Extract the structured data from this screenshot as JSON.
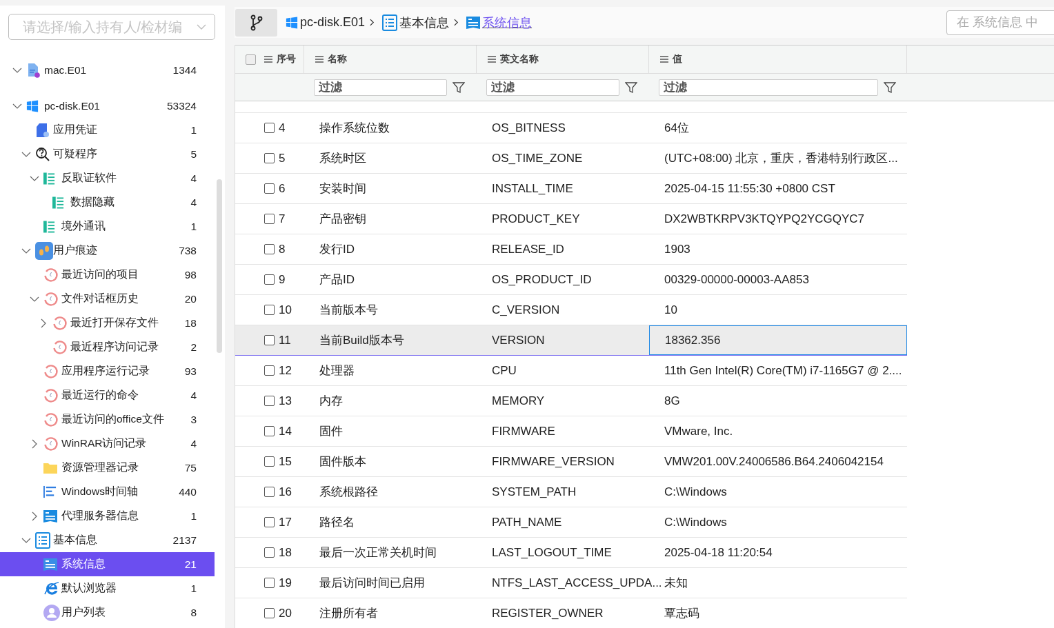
{
  "sidebar": {
    "owner_select": {
      "placeholder": "请选择/输入持有人/检材编"
    },
    "tree": [
      {
        "label": "mac.E01",
        "count": "1344",
        "kind": "disk-image",
        "expanded": true,
        "selected": false
      },
      {
        "label": "pc-disk.E01",
        "count": "53324",
        "kind": "windows",
        "expanded": true,
        "selected": false,
        "children": [
          {
            "label": "应用凭证",
            "count": "1",
            "kind": "credential",
            "selected": false
          },
          {
            "label": "可疑程序",
            "count": "5",
            "kind": "suspect",
            "expanded": true,
            "selected": false,
            "children": [
              {
                "label": "反取证软件",
                "count": "4",
                "kind": "green-list",
                "expanded": true,
                "selected": false,
                "children": [
                  {
                    "label": "数据隐藏",
                    "count": "4",
                    "kind": "green-list",
                    "selected": false
                  }
                ]
              },
              {
                "label": "境外通讯",
                "count": "1",
                "kind": "green-list",
                "selected": false
              }
            ]
          },
          {
            "label": "用户痕迹",
            "count": "738",
            "kind": "footprints",
            "expanded": true,
            "selected": false,
            "children": [
              {
                "label": "最近访问的项目",
                "count": "98",
                "kind": "history",
                "selected": false
              },
              {
                "label": "文件对话框历史",
                "count": "20",
                "kind": "history",
                "expanded": true,
                "selected": false,
                "children": [
                  {
                    "label": "最近打开保存文件",
                    "count": "18",
                    "kind": "history",
                    "expanded": false,
                    "selected": false
                  },
                  {
                    "label": "最近程序访问记录",
                    "count": "2",
                    "kind": "history",
                    "selected": false
                  }
                ]
              },
              {
                "label": "应用程序运行记录",
                "count": "93",
                "kind": "history",
                "selected": false
              },
              {
                "label": "最近运行的命令",
                "count": "4",
                "kind": "history",
                "selected": false
              },
              {
                "label": "最近访问的office文件",
                "count": "3",
                "kind": "history",
                "selected": false
              },
              {
                "label": "WinRAR访问记录",
                "count": "4",
                "kind": "history",
                "expanded": false,
                "selected": false
              },
              {
                "label": "资源管理器记录",
                "count": "75",
                "kind": "folder",
                "selected": false
              },
              {
                "label": "Windows时间轴",
                "count": "440",
                "kind": "timeline",
                "selected": false
              },
              {
                "label": "代理服务器信息",
                "count": "1",
                "kind": "card",
                "expanded": false,
                "selected": false
              }
            ]
          },
          {
            "label": "基本信息",
            "count": "2137",
            "kind": "doc-list",
            "expanded": true,
            "selected": false,
            "children": [
              {
                "label": "系统信息",
                "count": "21",
                "kind": "card",
                "selected": true
              },
              {
                "label": "默认浏览器",
                "count": "1",
                "kind": "browser",
                "selected": false
              },
              {
                "label": "用户列表",
                "count": "8",
                "kind": "user",
                "selected": false
              }
            ]
          }
        ]
      }
    ]
  },
  "breadcrumb": [
    {
      "label": "pc-disk.E01",
      "kind": "windows",
      "selected": false
    },
    {
      "label": "基本信息",
      "kind": "doc-list",
      "selected": false
    },
    {
      "label": "系统信息",
      "kind": "card",
      "selected": true
    }
  ],
  "search": {
    "placeholder": "在 系统信息 中"
  },
  "table": {
    "header_checked": false,
    "columns": [
      "序号",
      "名称",
      "英文名称",
      "值"
    ],
    "filters": [
      {
        "placeholder": "过滤"
      },
      {
        "placeholder": "过滤"
      },
      {
        "placeholder": "过滤"
      }
    ],
    "rows": [
      {
        "index": "4",
        "name": "操作系统位数",
        "english_name": "OS_BITNESS",
        "value": "64位",
        "checked": false,
        "selected": false
      },
      {
        "index": "5",
        "name": "系统时区",
        "english_name": "OS_TIME_ZONE",
        "value": "(UTC+08:00) 北京，重庆，香港特别行政区...",
        "checked": false,
        "selected": false
      },
      {
        "index": "6",
        "name": "安装时间",
        "english_name": "INSTALL_TIME",
        "value": "2025-04-15 11:55:30 +0800 CST",
        "checked": false,
        "selected": false
      },
      {
        "index": "7",
        "name": "产品密钥",
        "english_name": "PRODUCT_KEY",
        "value": "DX2WBTKRPV3KTQYPQ2YCGQYC7",
        "checked": false,
        "selected": false
      },
      {
        "index": "8",
        "name": "发行ID",
        "english_name": "RELEASE_ID",
        "value": "1903",
        "checked": false,
        "selected": false
      },
      {
        "index": "9",
        "name": "产品ID",
        "english_name": "OS_PRODUCT_ID",
        "value": "00329-00000-00003-AA853",
        "checked": false,
        "selected": false
      },
      {
        "index": "10",
        "name": "当前版本号",
        "english_name": "C_VERSION",
        "value": "10",
        "checked": false,
        "selected": false
      },
      {
        "index": "11",
        "name": "当前Build版本号",
        "english_name": "VERSION",
        "value": "18362.356",
        "checked": false,
        "selected": true
      },
      {
        "index": "12",
        "name": "处理器",
        "english_name": "CPU",
        "value": "11th Gen Intel(R) Core(TM) i7-1165G7 @ 2....",
        "checked": false,
        "selected": false
      },
      {
        "index": "13",
        "name": "内存",
        "english_name": "MEMORY",
        "value": "8G",
        "checked": false,
        "selected": false
      },
      {
        "index": "14",
        "name": "固件",
        "english_name": "FIRMWARE",
        "value": "VMware, Inc.",
        "checked": false,
        "selected": false
      },
      {
        "index": "15",
        "name": "固件版本",
        "english_name": "FIRMWARE_VERSION",
        "value": "VMW201.00V.24006586.B64.2406042154",
        "checked": false,
        "selected": false
      },
      {
        "index": "16",
        "name": "系统根路径",
        "english_name": "SYSTEM_PATH",
        "value": "C:\\Windows",
        "checked": false,
        "selected": false
      },
      {
        "index": "17",
        "name": "路径名",
        "english_name": "PATH_NAME",
        "value": "C:\\Windows",
        "checked": false,
        "selected": false
      },
      {
        "index": "18",
        "name": "最后一次正常关机时间",
        "english_name": "LAST_LOGOUT_TIME",
        "value": "2025-04-18 11:20:54",
        "checked": false,
        "selected": false
      },
      {
        "index": "19",
        "name": "最后访问时间已启用",
        "english_name": "NTFS_LAST_ACCESS_UPDA...",
        "value": "未知",
        "checked": false,
        "selected": false
      },
      {
        "index": "20",
        "name": "注册所有者",
        "english_name": "REGISTER_OWNER",
        "value": "覃志码",
        "checked": false,
        "selected": false
      }
    ]
  }
}
